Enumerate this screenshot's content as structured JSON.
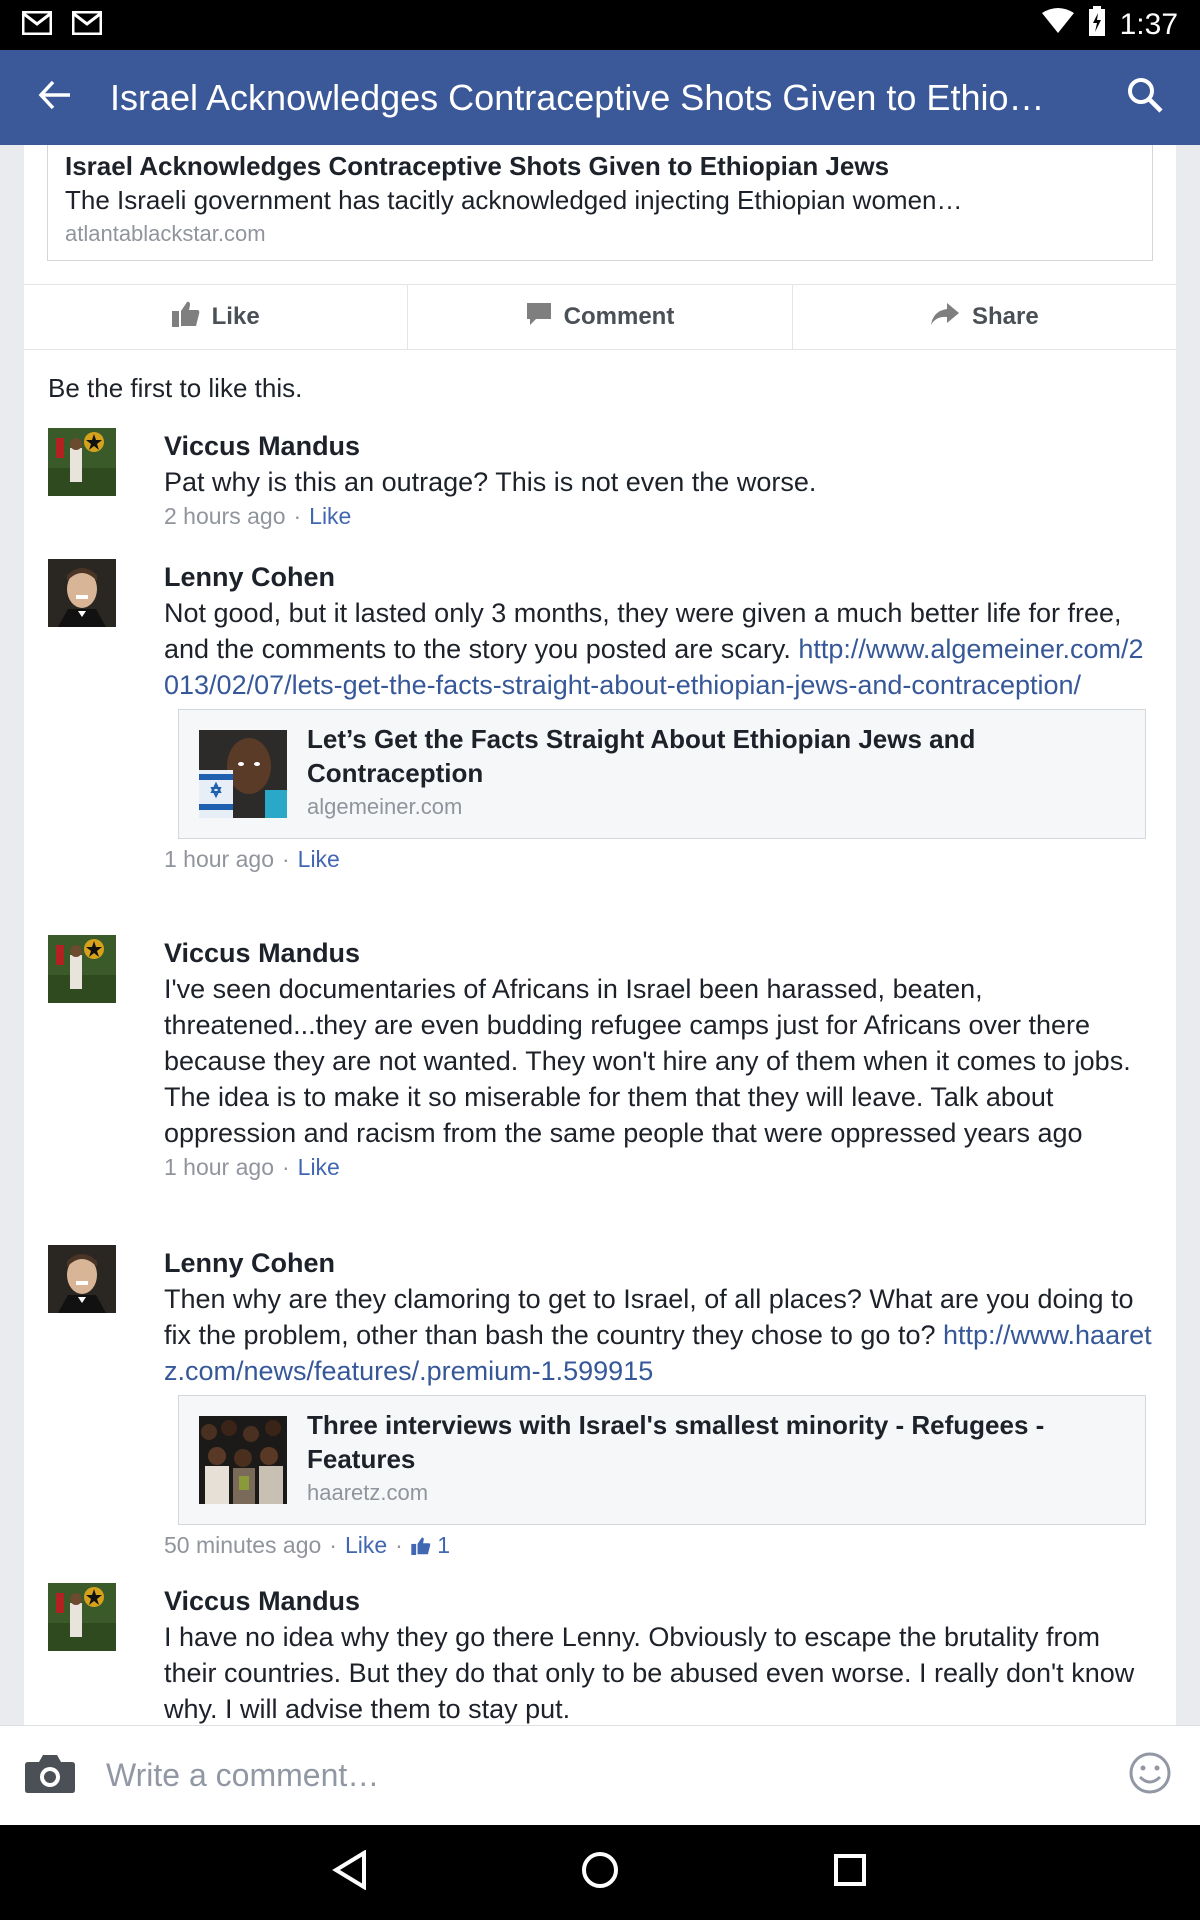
{
  "status_bar": {
    "time": "1:37",
    "icons": [
      "gmail-icon",
      "gmail-icon",
      "wifi-icon",
      "battery-icon"
    ]
  },
  "app_bar": {
    "title": "Israel Acknowledges Contraceptive Shots Given to Ethiopi…"
  },
  "shared_link": {
    "title": "Israel Acknowledges Contraceptive Shots Given to Ethiopian Jews",
    "description": "The Israeli government has tacitly acknowledged injecting Ethiopian women…",
    "domain": "atlantablackstar.com"
  },
  "actions": {
    "like": "Like",
    "comment": "Comment",
    "share": "Share"
  },
  "likes_summary": "Be the first to like this.",
  "comments": [
    {
      "author": "Viccus Mandus",
      "text": "Pat why is this an outrage? This is not even the worse.",
      "time": "2 hours ago",
      "like": "Like"
    },
    {
      "author": "Lenny Cohen",
      "text": "Not good, but it lasted only 3 months, they were given a much better life for free, and the comments to the story you posted are scary. ",
      "link": "http://www.algemeiner.com/2013/02/07/lets-get-the-facts-straight-about-ethiopian-jews-and-contraception/",
      "card_title": "Let’s Get the Facts Straight About Ethiopian Jews and Contraception",
      "card_domain": "algemeiner.com",
      "time": "1 hour ago",
      "like": "Like"
    },
    {
      "author": "Viccus Mandus",
      "text": "I've seen documentaries of Africans in Israel been harassed, beaten, threatened...they are even budding refugee camps just for Africans over there because they are not wanted.   They won't hire any of them when it comes to jobs.  The idea is to make it so miserable for them that they will leave.  Talk about oppression and racism from the same people that were oppressed years ago",
      "time": "1 hour ago",
      "like": "Like"
    },
    {
      "author": "Lenny Cohen",
      "text": "Then why are they clamoring to get to Israel, of all places? What are you doing to fix the problem, other than bash the country they chose to go to? ",
      "link": "http://www.haaretz.com/news/features/.premium-1.599915",
      "card_title": "Three interviews with Israel's smallest minority - Refugees - Features",
      "card_domain": "haaretz.com",
      "time": "50 minutes ago",
      "like": "Like",
      "like_count": "1"
    },
    {
      "author": "Viccus Mandus",
      "text": "I have no idea why they go there Lenny.  Obviously to escape the brutality from their countries.  But they do that only to be abused even worse.  I really don't know why.  I will advise them to stay put."
    }
  ],
  "composer": {
    "placeholder": "Write a comment…"
  },
  "colors": {
    "brand": "#3b5998",
    "link": "#365899",
    "meta": "#90949c"
  }
}
